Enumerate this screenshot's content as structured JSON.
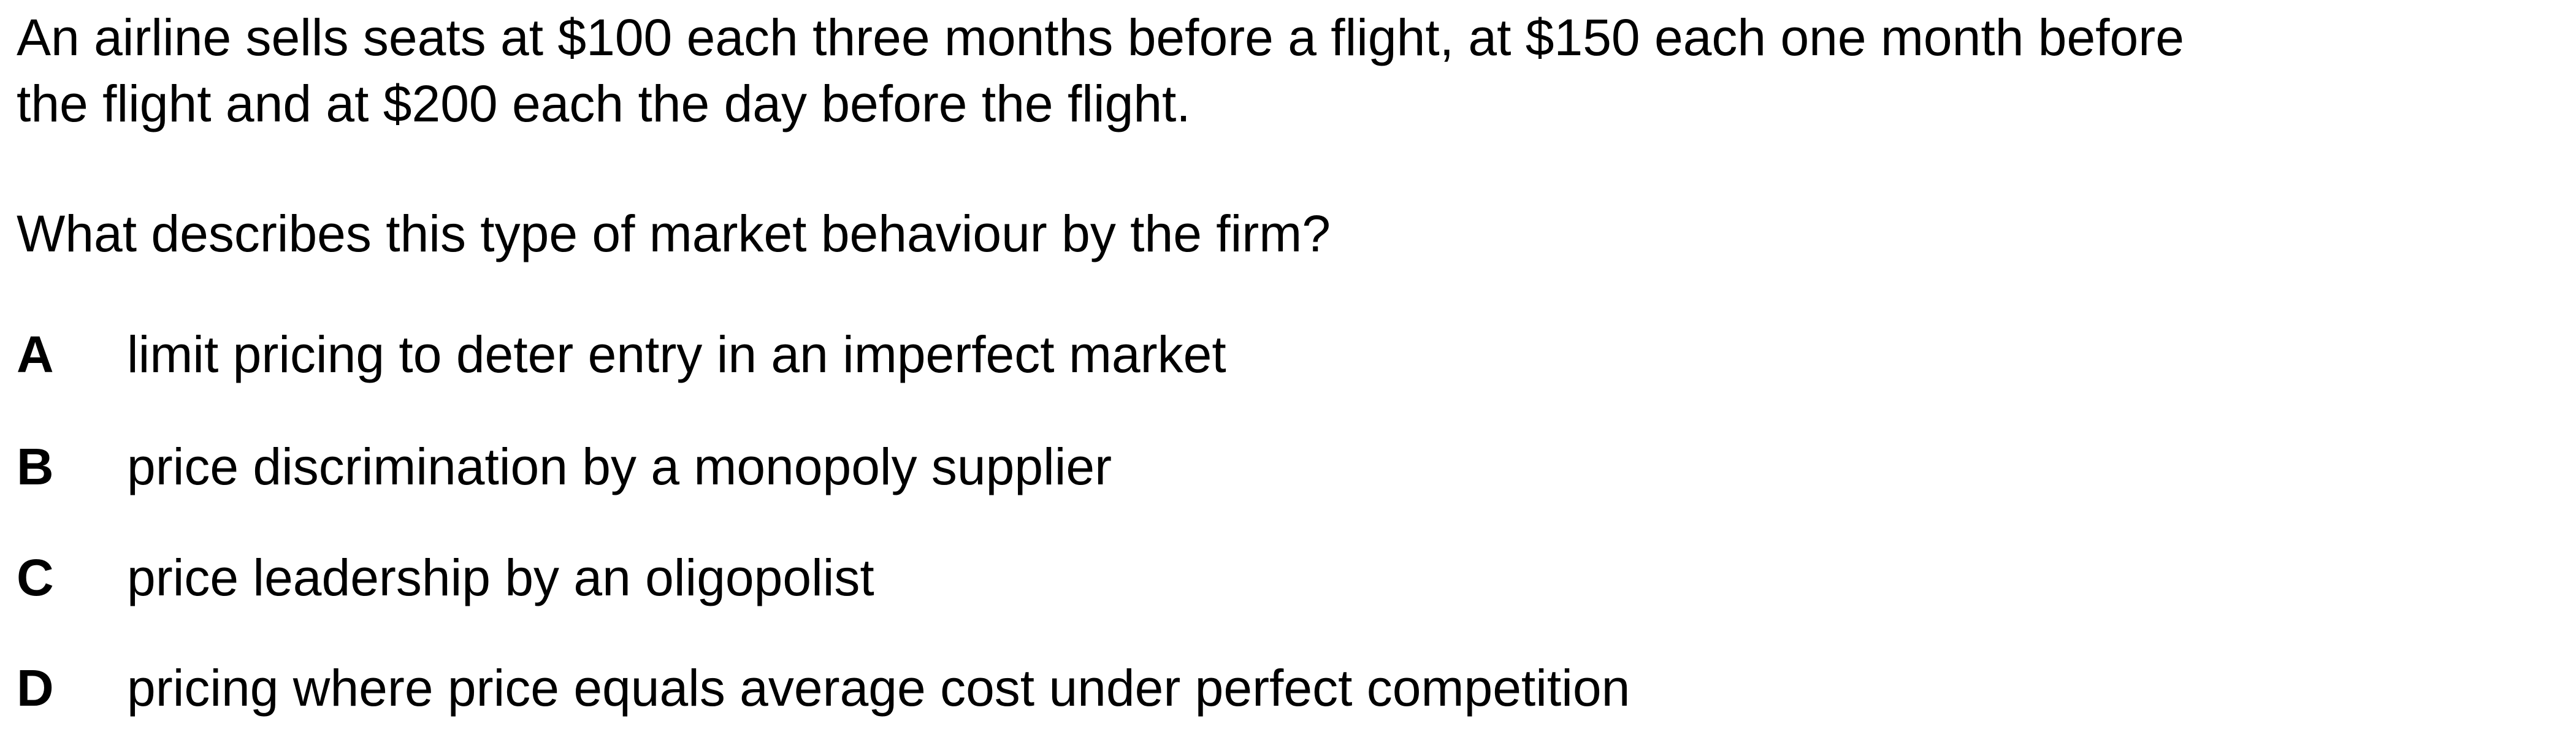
{
  "stem": {
    "line1": "An airline sells seats at $100 each three months before a flight, at $150 each one month before",
    "line2": "the flight and at $200 each the day before the flight."
  },
  "question": "What describes this type of market behaviour by the firm?",
  "options": [
    {
      "letter": "A",
      "text": "limit pricing to deter entry in an imperfect market"
    },
    {
      "letter": "B",
      "text": "price discrimination by a monopoly supplier"
    },
    {
      "letter": "C",
      "text": "price leadership by an oligopolist"
    },
    {
      "letter": "D",
      "text": "pricing where price equals average cost under perfect competition"
    }
  ]
}
